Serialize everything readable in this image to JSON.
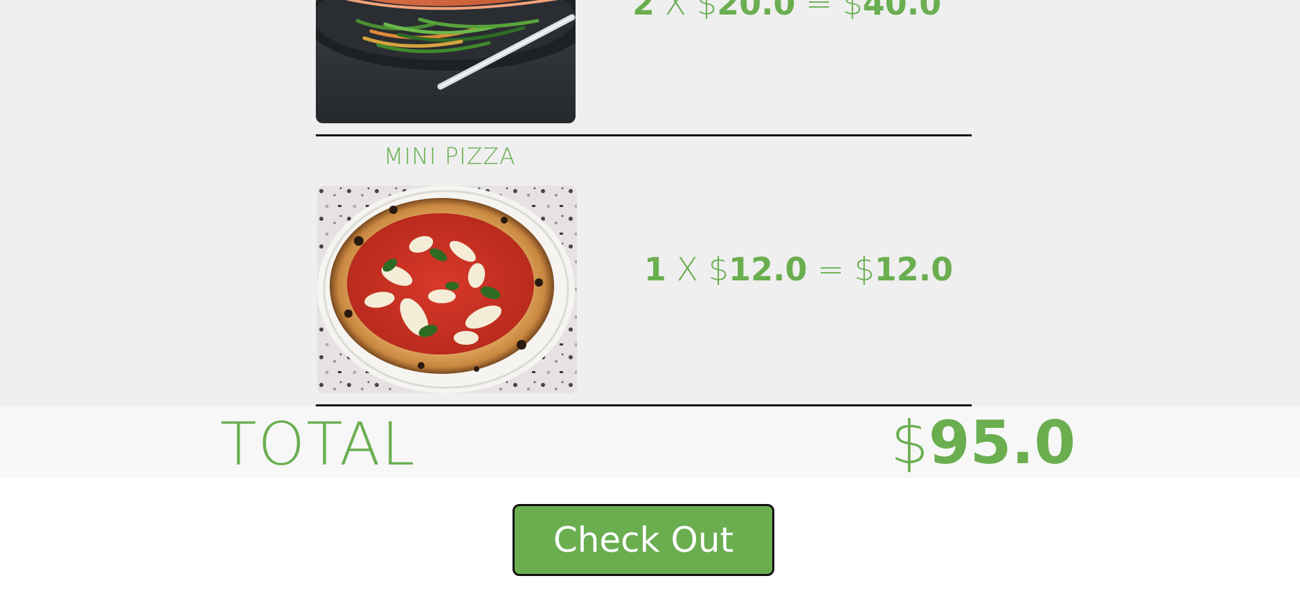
{
  "cart": {
    "items": [
      {
        "name": "",
        "quantity": "2",
        "times": "X",
        "currency": "$",
        "unit_price": "20.0",
        "equals": "=",
        "line_total": "40.0",
        "image": "salmon-dish-photo"
      },
      {
        "name": "MINI PIZZA",
        "quantity": "1",
        "times": "X",
        "currency": "$",
        "unit_price": "12.0",
        "equals": "=",
        "line_total": "12.0",
        "image": "margherita-pizza-photo"
      }
    ]
  },
  "total": {
    "label": "TOTAL",
    "currency": "$",
    "amount": "95.0"
  },
  "checkout": {
    "label": "Check Out"
  },
  "colors": {
    "accent_green": "#6aae50",
    "cart_background": "#efefef",
    "total_bar_background": "#f7f7f7",
    "divider": "#111111"
  }
}
